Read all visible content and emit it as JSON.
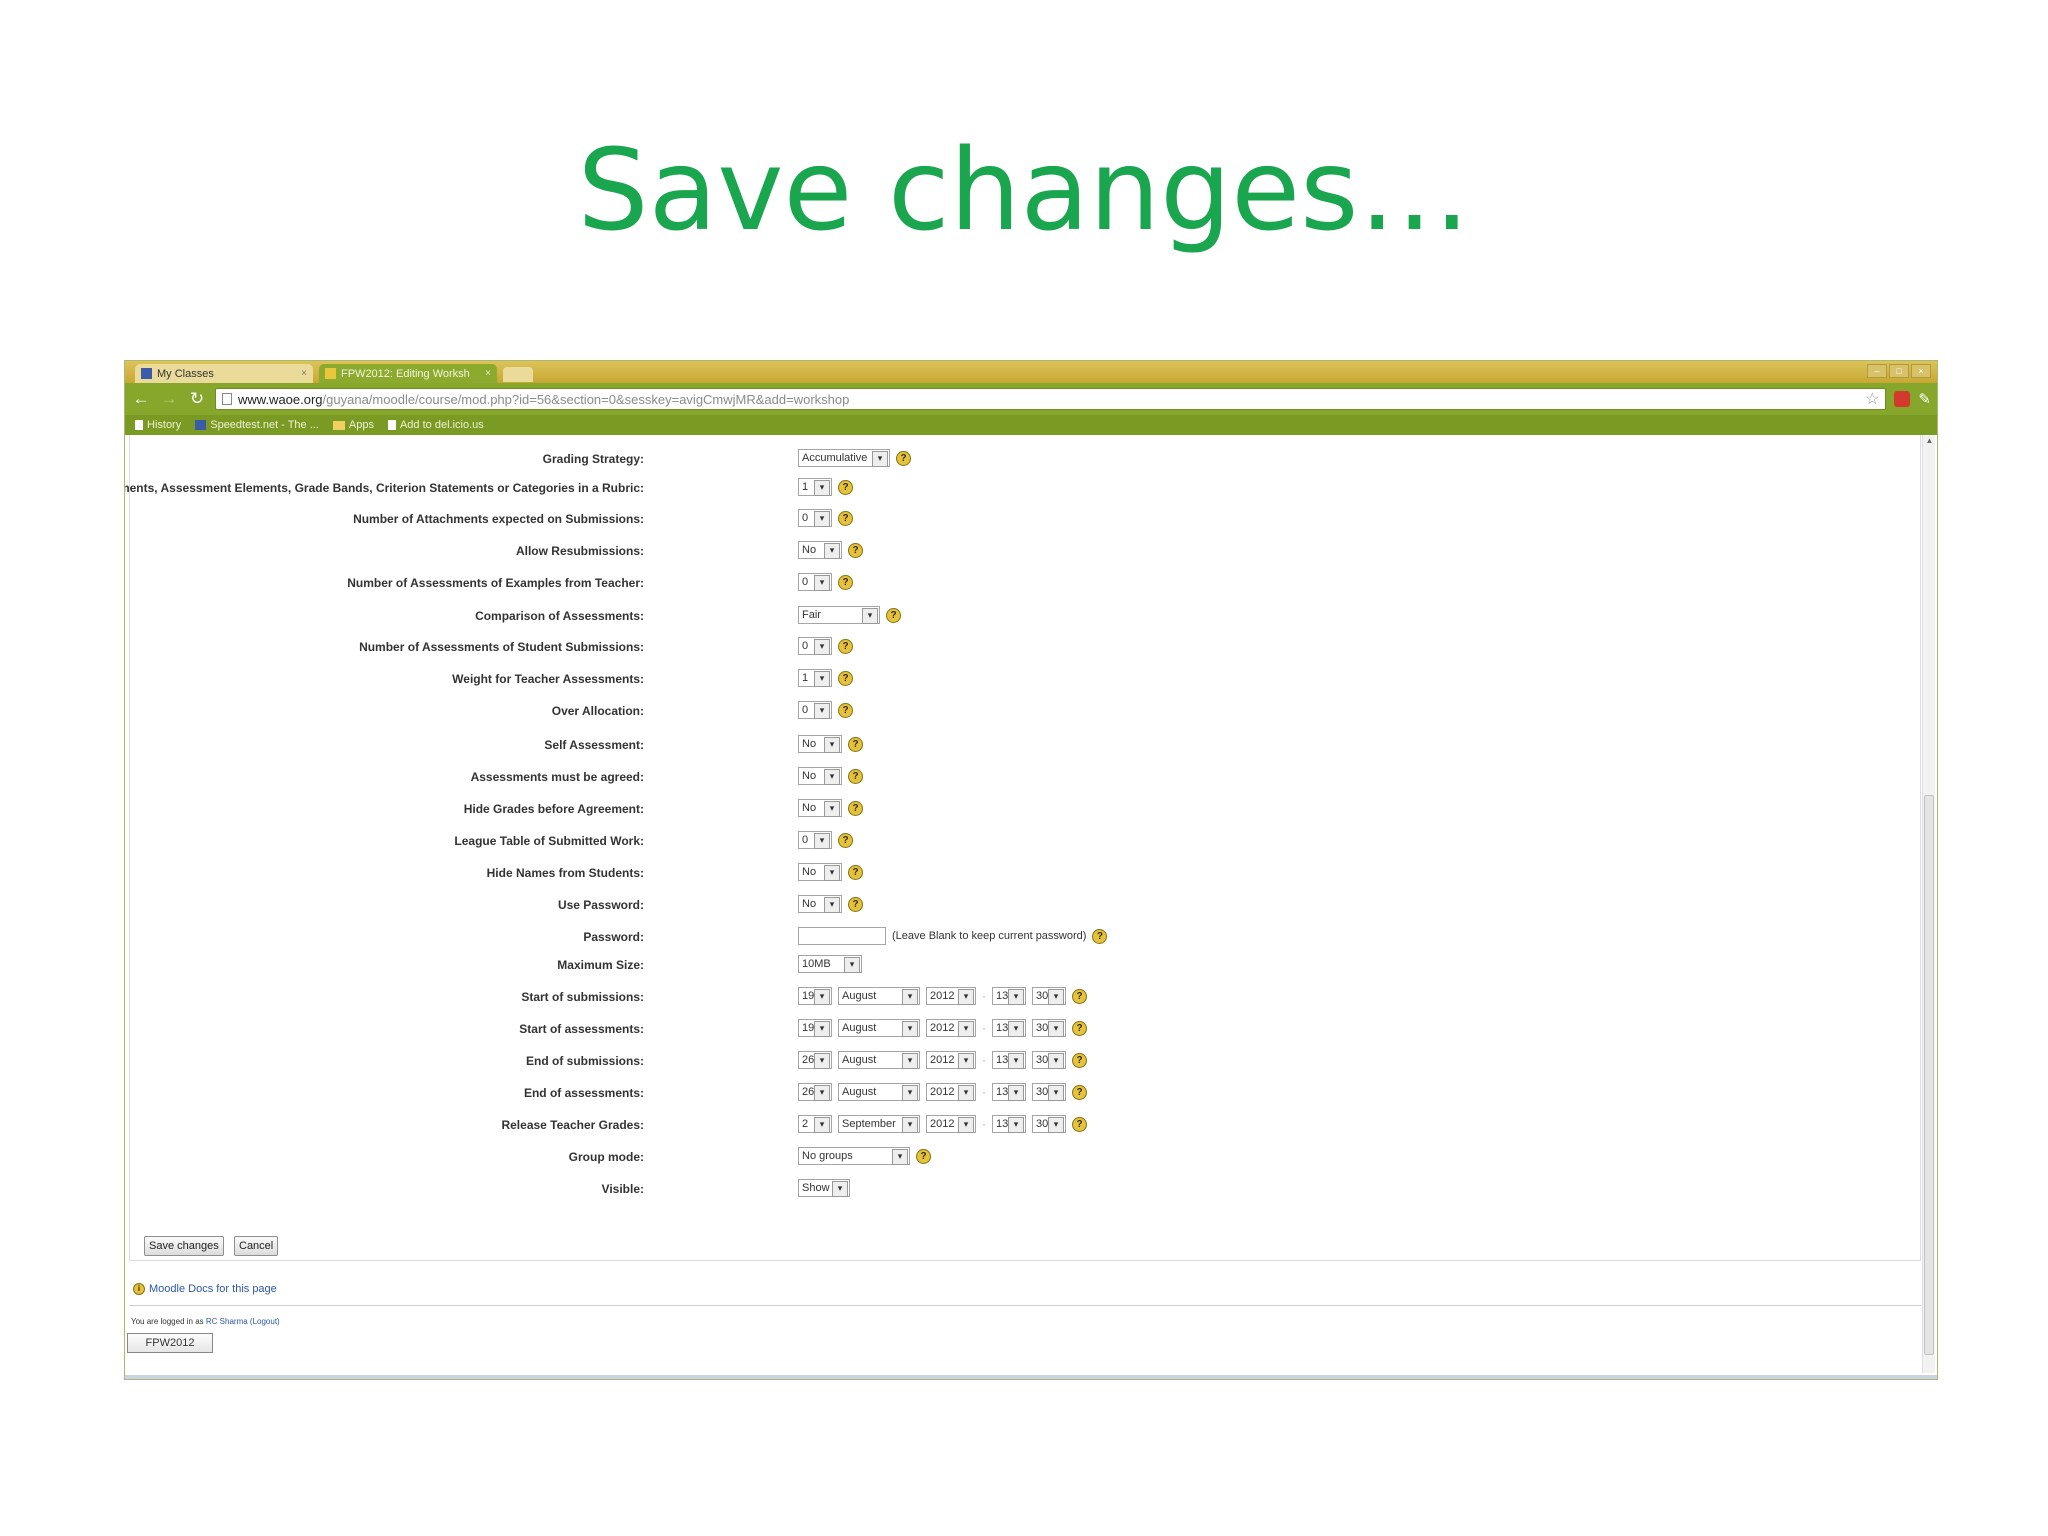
{
  "slide": {
    "title": "Save changes…"
  },
  "browser": {
    "tabs": [
      {
        "label": "My Classes"
      },
      {
        "label": "FPW2012: Editing Worksh"
      }
    ],
    "url_host": "www.waoe.org",
    "url_path": "/guyana/moodle/course/mod.php?id=56&section=0&sesskey=avigCmwjMR&add=workshop",
    "bookmarks": [
      {
        "label": "History"
      },
      {
        "label": "Speedtest.net - The ..."
      },
      {
        "label": "Apps"
      },
      {
        "label": "Add to del.icio.us"
      }
    ]
  },
  "form": {
    "rows": [
      {
        "label": "Grading Strategy:",
        "controls": [
          {
            "type": "select",
            "value": "Accumulative"
          }
        ]
      },
      {
        "label": "Number of Comments, Assessment Elements, Grade Bands, Criterion Statements or Categories in a Rubric:",
        "controls": [
          {
            "type": "select",
            "value": "1"
          }
        ]
      },
      {
        "label": "Number of Attachments expected on Submissions:",
        "controls": [
          {
            "type": "select",
            "value": "0"
          }
        ]
      },
      {
        "label": "Allow Resubmissions:",
        "controls": [
          {
            "type": "select",
            "value": "No"
          }
        ]
      },
      {
        "label": "Number of Assessments of Examples from Teacher:",
        "controls": [
          {
            "type": "select",
            "value": "0"
          }
        ]
      },
      {
        "label": "Comparison of Assessments:",
        "controls": [
          {
            "type": "select",
            "value": "Fair"
          }
        ]
      },
      {
        "label": "Number of Assessments of Student Submissions:",
        "controls": [
          {
            "type": "select",
            "value": "0"
          }
        ]
      },
      {
        "label": "Weight for Teacher Assessments:",
        "controls": [
          {
            "type": "select",
            "value": "1"
          }
        ]
      },
      {
        "label": "Over Allocation:",
        "controls": [
          {
            "type": "select",
            "value": "0"
          }
        ]
      },
      {
        "label": "Self Assessment:",
        "controls": [
          {
            "type": "select",
            "value": "No"
          }
        ]
      },
      {
        "label": "Assessments must be agreed:",
        "controls": [
          {
            "type": "select",
            "value": "No"
          }
        ]
      },
      {
        "label": "Hide Grades before Agreement:",
        "controls": [
          {
            "type": "select",
            "value": "No"
          }
        ]
      },
      {
        "label": "League Table of Submitted Work:",
        "controls": [
          {
            "type": "select",
            "value": "0"
          }
        ]
      },
      {
        "label": "Hide Names from Students:",
        "controls": [
          {
            "type": "select",
            "value": "No"
          }
        ]
      },
      {
        "label": "Use Password:",
        "controls": [
          {
            "type": "select",
            "value": "No"
          }
        ]
      },
      {
        "label": "Password:",
        "controls": [
          {
            "type": "text",
            "value": ""
          }
        ],
        "note": "(Leave Blank to keep current password)"
      },
      {
        "label": "Maximum Size:",
        "controls": [
          {
            "type": "select",
            "value": "10MB"
          }
        ],
        "no_help": true
      },
      {
        "label": "Start of submissions:",
        "controls": [
          {
            "type": "select",
            "value": "19"
          },
          {
            "type": "select",
            "value": "August"
          },
          {
            "type": "select",
            "value": "2012"
          },
          {
            "type": "select",
            "value": "13"
          },
          {
            "type": "select",
            "value": "30"
          }
        ]
      },
      {
        "label": "Start of assessments:",
        "controls": [
          {
            "type": "select",
            "value": "19"
          },
          {
            "type": "select",
            "value": "August"
          },
          {
            "type": "select",
            "value": "2012"
          },
          {
            "type": "select",
            "value": "13"
          },
          {
            "type": "select",
            "value": "30"
          }
        ]
      },
      {
        "label": "End of submissions:",
        "controls": [
          {
            "type": "select",
            "value": "26"
          },
          {
            "type": "select",
            "value": "August"
          },
          {
            "type": "select",
            "value": "2012"
          },
          {
            "type": "select",
            "value": "13"
          },
          {
            "type": "select",
            "value": "30"
          }
        ]
      },
      {
        "label": "End of assessments:",
        "controls": [
          {
            "type": "select",
            "value": "26"
          },
          {
            "type": "select",
            "value": "August"
          },
          {
            "type": "select",
            "value": "2012"
          },
          {
            "type": "select",
            "value": "13"
          },
          {
            "type": "select",
            "value": "30"
          }
        ]
      },
      {
        "label": "Release Teacher Grades:",
        "controls": [
          {
            "type": "select",
            "value": "2"
          },
          {
            "type": "select",
            "value": "September"
          },
          {
            "type": "select",
            "value": "2012"
          },
          {
            "type": "select",
            "value": "13"
          },
          {
            "type": "select",
            "value": "30"
          }
        ]
      },
      {
        "label": "Group mode:",
        "controls": [
          {
            "type": "select",
            "value": "No groups"
          }
        ]
      },
      {
        "label": "Visible:",
        "controls": [
          {
            "type": "select",
            "value": "Show"
          }
        ],
        "no_help": true
      }
    ],
    "save_label": "Save changes",
    "cancel_label": "Cancel"
  },
  "footer": {
    "docs_link": "Moodle Docs for this page",
    "logged_in_prefix": "You are logged in as",
    "logged_in_user": "RC Sharma",
    "logout_label": "(Logout)",
    "course_button": "FPW2012"
  },
  "colors": {
    "title_green": "#1aa64f",
    "browser_chrome": "#86a62c"
  }
}
